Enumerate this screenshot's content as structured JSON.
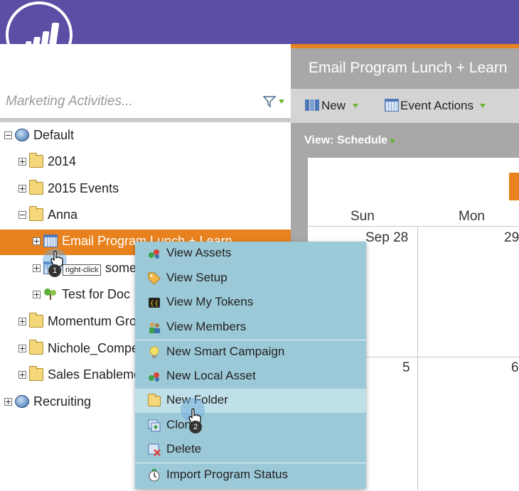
{
  "app": {
    "brand_color": "#5a4fa5",
    "accent_color": "#e8821e"
  },
  "search": {
    "placeholder": "Marketing Activities..."
  },
  "tree": {
    "items": [
      {
        "label": "Default",
        "icon": "globe-icon",
        "toggle": "minus"
      },
      {
        "label": "2014",
        "icon": "folder-icon",
        "toggle": "plus"
      },
      {
        "label": "2015 Events",
        "icon": "folder-icon",
        "toggle": "plus"
      },
      {
        "label": "Anna",
        "icon": "folder-icon",
        "toggle": "minus"
      },
      {
        "label": "Email Program Lunch + Learn",
        "icon": "calendar-program-icon",
        "toggle": "plus",
        "selected": true
      },
      {
        "label": "some",
        "icon": "calendar-program-icon",
        "toggle": "plus"
      },
      {
        "label": "Test for Doc",
        "icon": "smart-campaign-icon",
        "toggle": "plus"
      },
      {
        "label": "Momentum Gro",
        "icon": "folder-icon",
        "toggle": "plus"
      },
      {
        "label": "Nichole_Compe",
        "icon": "folder-icon",
        "toggle": "plus"
      },
      {
        "label": "Sales Enableme",
        "icon": "folder-icon",
        "toggle": "plus"
      },
      {
        "label": "Recruiting",
        "icon": "globe-icon",
        "toggle": "plus"
      }
    ]
  },
  "header": {
    "title": "Email Program Lunch + Learn"
  },
  "toolbar": {
    "new_label": "New",
    "event_actions_label": "Event Actions"
  },
  "view": {
    "label": "View: Schedule"
  },
  "calendar": {
    "days": [
      "Sun",
      "Mon"
    ],
    "row1": [
      "Sep 28",
      "29"
    ],
    "row2": [
      "5",
      "6"
    ]
  },
  "context_menu": {
    "items": [
      {
        "label": "View Assets",
        "icon": "assets-icon"
      },
      {
        "label": "View Setup",
        "icon": "tag-icon"
      },
      {
        "label": "View My Tokens",
        "icon": "tokens-icon"
      },
      {
        "label": "View Members",
        "icon": "members-icon"
      },
      {
        "label": "New Smart Campaign",
        "icon": "lightbulb-icon"
      },
      {
        "label": "New Local Asset",
        "icon": "assets-icon"
      },
      {
        "label": "New Folder",
        "icon": "folder-icon"
      },
      {
        "label": "Clone",
        "icon": "clone-icon"
      },
      {
        "label": "Delete",
        "icon": "delete-icon"
      },
      {
        "label": "Import Program Status",
        "icon": "import-status-icon"
      }
    ]
  },
  "callouts": {
    "step1": "1",
    "step1_tip": "right-click",
    "step2": "2"
  }
}
